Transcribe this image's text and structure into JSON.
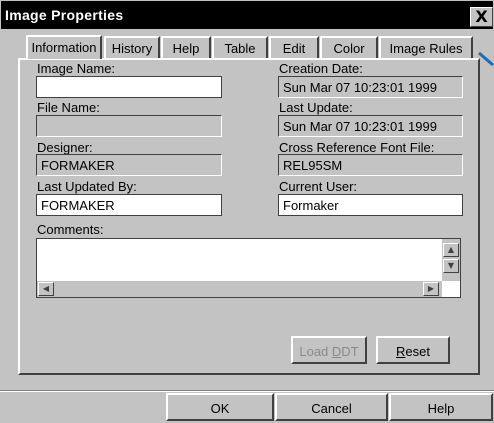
{
  "window": {
    "title": "Image Properties",
    "close_glyph": "X"
  },
  "tabs": [
    {
      "label": "Information",
      "active": true
    },
    {
      "label": "History",
      "active": false
    },
    {
      "label": "Help",
      "active": false
    },
    {
      "label": "Table",
      "active": false
    },
    {
      "label": "Edit",
      "active": false
    },
    {
      "label": "Color",
      "active": false
    },
    {
      "label": "Image Rules",
      "active": false
    }
  ],
  "fields": {
    "image_name": {
      "label": "Image Name:",
      "value": ""
    },
    "file_name": {
      "label": "File Name:",
      "value": ""
    },
    "designer": {
      "label": "Designer:",
      "value": "FORMAKER"
    },
    "last_updated_by": {
      "label": "Last Updated By:",
      "value": "FORMAKER"
    },
    "creation_date": {
      "label": "Creation Date:",
      "value": "Sun Mar 07 10:23:01 1999"
    },
    "last_update": {
      "label": "Last Update:",
      "value": "Sun Mar 07 10:23:01 1999"
    },
    "cross_ref_font_file": {
      "label": "Cross Reference Font File:",
      "value": "REL95SM"
    },
    "current_user": {
      "label": "Current User:",
      "value": "Formaker"
    },
    "comments": {
      "label": "Comments:",
      "value": ""
    }
  },
  "panel_buttons": {
    "load_ddt": {
      "label_pre": "Load ",
      "mnemonic": "D",
      "label_post": "DT",
      "enabled": false
    },
    "reset": {
      "mnemonic": "R",
      "label_post": "eset",
      "enabled": true
    }
  },
  "dialog_buttons": {
    "ok": "OK",
    "cancel": "Cancel",
    "help": "Help"
  },
  "scroll_glyphs": {
    "up": "▲",
    "down": "▼",
    "left": "◀",
    "right": "▶"
  },
  "colors": {
    "title_bar": "#000000",
    "dialog_bg": "#c3c3c3",
    "accent_mark": "#1a6fb5"
  }
}
